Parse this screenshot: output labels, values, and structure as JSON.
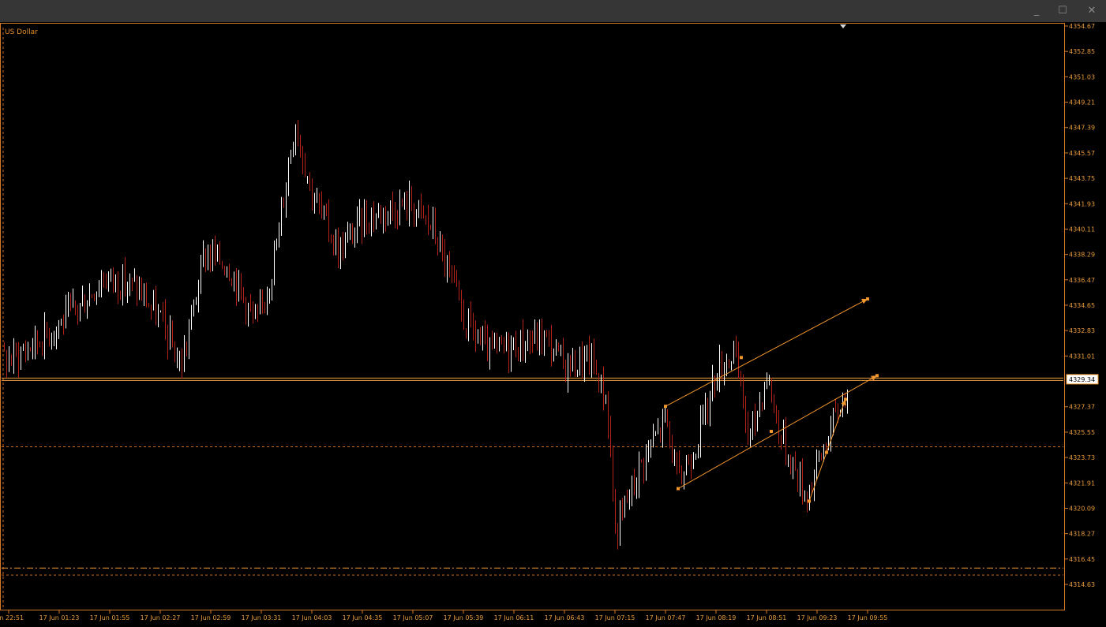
{
  "window": {
    "controls": {
      "minimize": "_",
      "maximize": "☐",
      "close": "✕"
    }
  },
  "chart": {
    "symbol_label": "US Dollar",
    "colors": {
      "background": "#000000",
      "frame": "#d47a26",
      "axis_text": "#e69a3a",
      "bull_candle": "#ffffff",
      "bear_candle": "#b3211a",
      "trendline": "#f2962e",
      "dashed_level": "#c96a1f",
      "current_price_line": "#f2a240"
    },
    "current_price": "4329.34",
    "price_axis_labels": [
      "4354.67",
      "4352.85",
      "4351.03",
      "4349.21",
      "4347.39",
      "4345.57",
      "4343.75",
      "4341.93",
      "4340.11",
      "4338.29",
      "4336.47",
      "4334.65",
      "4332.83",
      "4331.01",
      "4327.37",
      "4325.55",
      "4323.73",
      "4321.91",
      "4320.09",
      "4318.27",
      "4316.45",
      "4314.63"
    ],
    "time_axis_labels": [
      "Jun 22:51",
      "17 Jun 01:23",
      "17 Jun 01:55",
      "17 Jun 02:27",
      "17 Jun 02:59",
      "17 Jun 03:31",
      "17 Jun 04:03",
      "17 Jun 04:35",
      "17 Jun 05:07",
      "17 Jun 05:39",
      "17 Jun 06:11",
      "17 Jun 06:43",
      "17 Jun 07:15",
      "17 Jun 07:47",
      "17 Jun 08:19",
      "17 Jun 08:51",
      "17 Jun 09:23",
      "17 Jun 09:55"
    ],
    "levels": {
      "current_price": 4329.34,
      "dashed_level_1": 4324.5,
      "dash_dot_level": 4315.8,
      "dashed_level_2": 4315.3
    },
    "trendlines": [
      {
        "name": "channel-upper-line",
        "from": [
          "17 Jun 07:47",
          4327.4
        ],
        "mid": [
          "17 Jun 08:35",
          4330.9
        ],
        "to": [
          "17 Jun 09:55",
          4335.1
        ]
      },
      {
        "name": "channel-lower-line",
        "from": [
          "17 Jun 07:55",
          4321.5
        ],
        "mid": [
          "17 Jun 08:54",
          4325.6
        ],
        "to": [
          "17 Jun 10:01",
          4329.6
        ]
      },
      {
        "name": "wedge-support-line",
        "from": [
          "17 Jun 09:18",
          4320.6
        ],
        "mid": [
          "17 Jun 09:29",
          4324.1
        ],
        "to": [
          "17 Jun 09:41",
          4327.9
        ]
      }
    ]
  },
  "chart_data": {
    "type": "candlestick",
    "title": "US Dollar",
    "xlabel": "",
    "ylabel": "",
    "ylim": [
      4313.9,
      4355.4
    ],
    "x_start": "16 Jun 22:51",
    "x_end": "17 Jun 10:03",
    "grid": false,
    "points_close": [
      [
        "16 Jun 22:51",
        4331.0
      ],
      [
        "17 Jun 00:52",
        4330.8
      ],
      [
        "17 Jun 01:10",
        4332.2
      ],
      [
        "17 Jun 01:35",
        4334.5
      ],
      [
        "17 Jun 01:51",
        4336.7
      ],
      [
        "17 Jun 02:12",
        4335.9
      ],
      [
        "17 Jun 02:27",
        4333.6
      ],
      [
        "17 Jun 02:40",
        4330.2
      ],
      [
        "17 Jun 02:55",
        4338.4
      ],
      [
        "17 Jun 03:10",
        4337.6
      ],
      [
        "17 Jun 03:28",
        4333.1
      ],
      [
        "17 Jun 03:40",
        4338.5
      ],
      [
        "17 Jun 03:52",
        4348.0
      ],
      [
        "17 Jun 04:03",
        4342.7
      ],
      [
        "17 Jun 04:20",
        4338.5
      ],
      [
        "17 Jun 04:35",
        4340.8
      ],
      [
        "17 Jun 04:50",
        4341.5
      ],
      [
        "17 Jun 05:05",
        4342.0
      ],
      [
        "17 Jun 05:20",
        4340.1
      ],
      [
        "17 Jun 05:39",
        4333.6
      ],
      [
        "17 Jun 05:55",
        4331.2
      ],
      [
        "17 Jun 06:11",
        4331.8
      ],
      [
        "17 Jun 06:30",
        4332.4
      ],
      [
        "17 Jun 06:43",
        4330.3
      ],
      [
        "17 Jun 07:00",
        4330.8
      ],
      [
        "17 Jun 07:10",
        4327.6
      ],
      [
        "17 Jun 07:15",
        4318.3
      ],
      [
        "17 Jun 07:30",
        4323.0
      ],
      [
        "17 Jun 07:47",
        4326.6
      ],
      [
        "17 Jun 07:55",
        4321.8
      ],
      [
        "17 Jun 08:10",
        4326.1
      ],
      [
        "17 Jun 08:19",
        4329.9
      ],
      [
        "17 Jun 08:30",
        4331.4
      ],
      [
        "17 Jun 08:40",
        4325.0
      ],
      [
        "17 Jun 08:51",
        4329.7
      ],
      [
        "17 Jun 09:00",
        4325.2
      ],
      [
        "17 Jun 09:16",
        4321.0
      ],
      [
        "17 Jun 09:30",
        4325.4
      ],
      [
        "17 Jun 09:45",
        4329.6
      ]
    ]
  }
}
